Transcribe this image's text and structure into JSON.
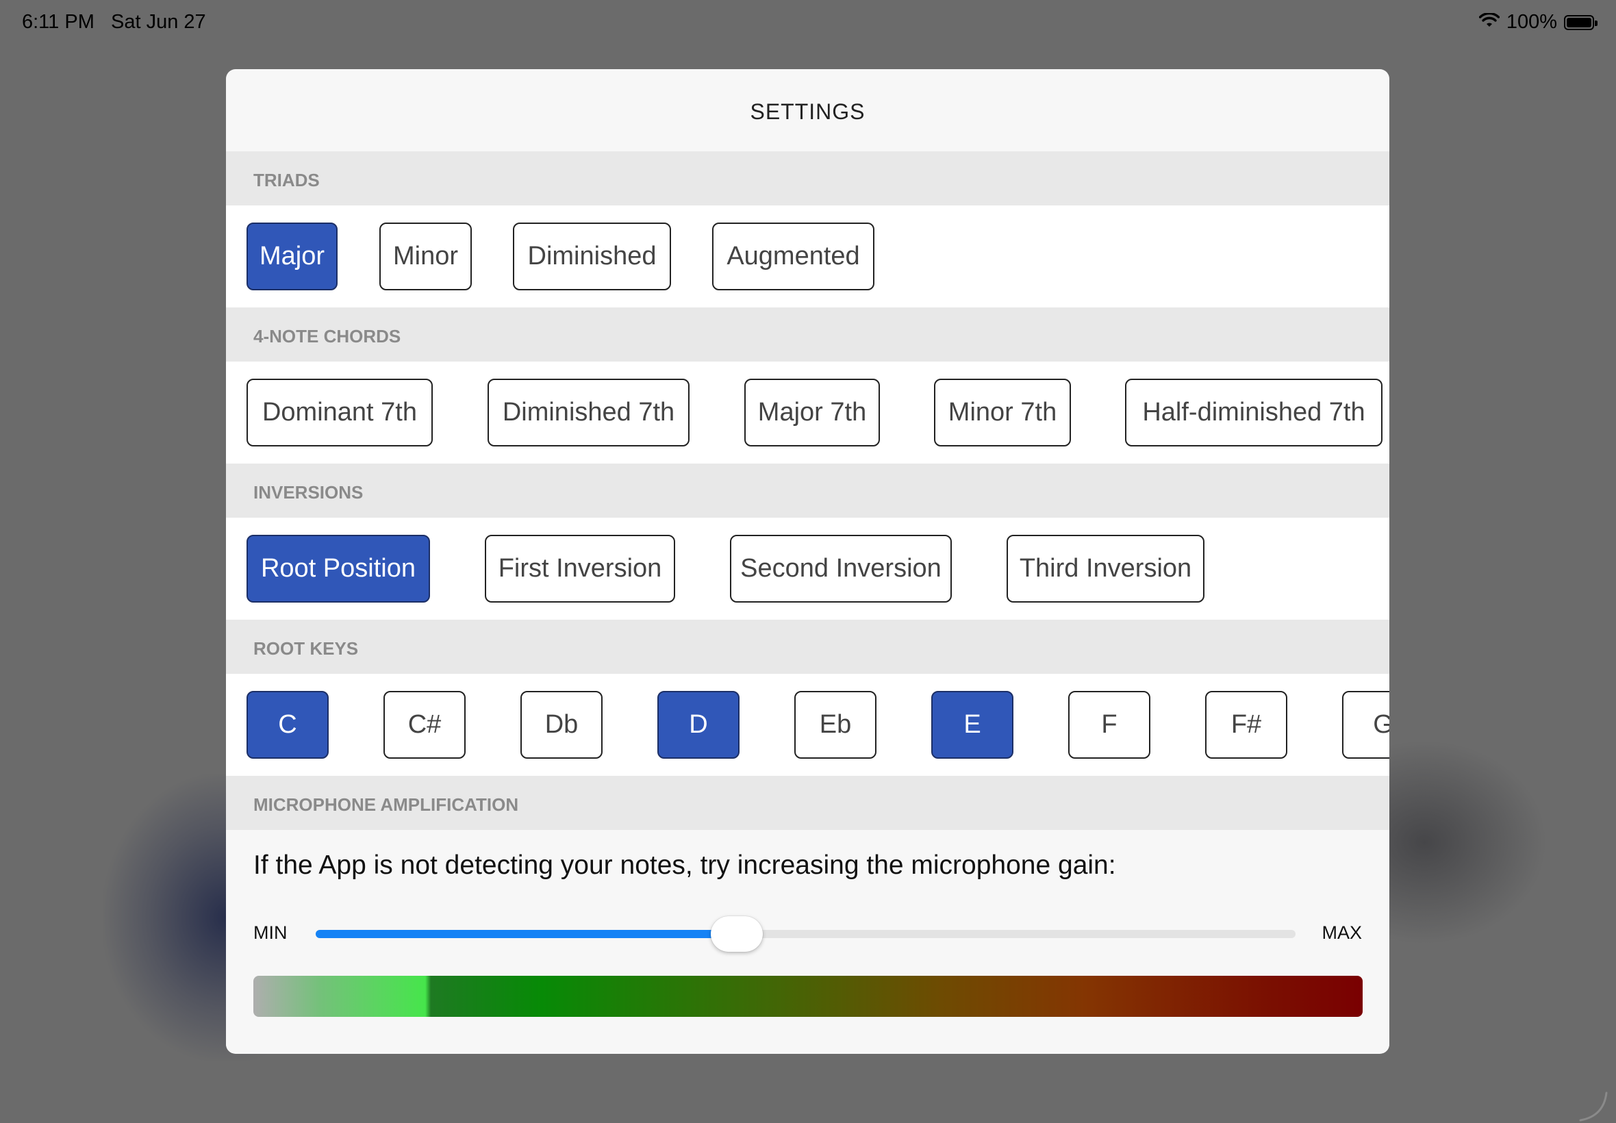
{
  "status": {
    "time": "6:11 PM",
    "date": "Sat Jun 27",
    "battery": "100%"
  },
  "modal": {
    "title": "SETTINGS"
  },
  "sections": {
    "triads": {
      "header": "TRIADS",
      "options": [
        {
          "label": "Major",
          "selected": true
        },
        {
          "label": "Minor",
          "selected": false
        },
        {
          "label": "Diminished",
          "selected": false
        },
        {
          "label": "Augmented",
          "selected": false
        }
      ]
    },
    "four_note": {
      "header": "4-NOTE CHORDS",
      "options": [
        {
          "label": "Dominant 7th",
          "selected": false
        },
        {
          "label": "Diminished 7th",
          "selected": false
        },
        {
          "label": "Major 7th",
          "selected": false
        },
        {
          "label": "Minor 7th",
          "selected": false
        },
        {
          "label": "Half-diminished 7th",
          "selected": false
        }
      ]
    },
    "inversions": {
      "header": "INVERSIONS",
      "options": [
        {
          "label": "Root Position",
          "selected": true
        },
        {
          "label": "First Inversion",
          "selected": false
        },
        {
          "label": "Second Inversion",
          "selected": false
        },
        {
          "label": "Third Inversion",
          "selected": false
        }
      ]
    },
    "root_keys": {
      "header": "ROOT KEYS",
      "options": [
        {
          "label": "C",
          "selected": true
        },
        {
          "label": "C#",
          "selected": false
        },
        {
          "label": "Db",
          "selected": false
        },
        {
          "label": "D",
          "selected": true
        },
        {
          "label": "Eb",
          "selected": false
        },
        {
          "label": "E",
          "selected": true
        },
        {
          "label": "F",
          "selected": false
        },
        {
          "label": "F#",
          "selected": false
        },
        {
          "label": "G",
          "selected": false
        }
      ]
    },
    "mic": {
      "header": "MICROPHONE AMPLIFICATION",
      "description": "If the App is not detecting your notes, try increasing the microphone gain:",
      "min_label": "MIN",
      "max_label": "MAX",
      "gain": 0.43,
      "level": 0.16
    }
  },
  "colors": {
    "selected": "#3057b8",
    "slider": "#1683f5"
  }
}
